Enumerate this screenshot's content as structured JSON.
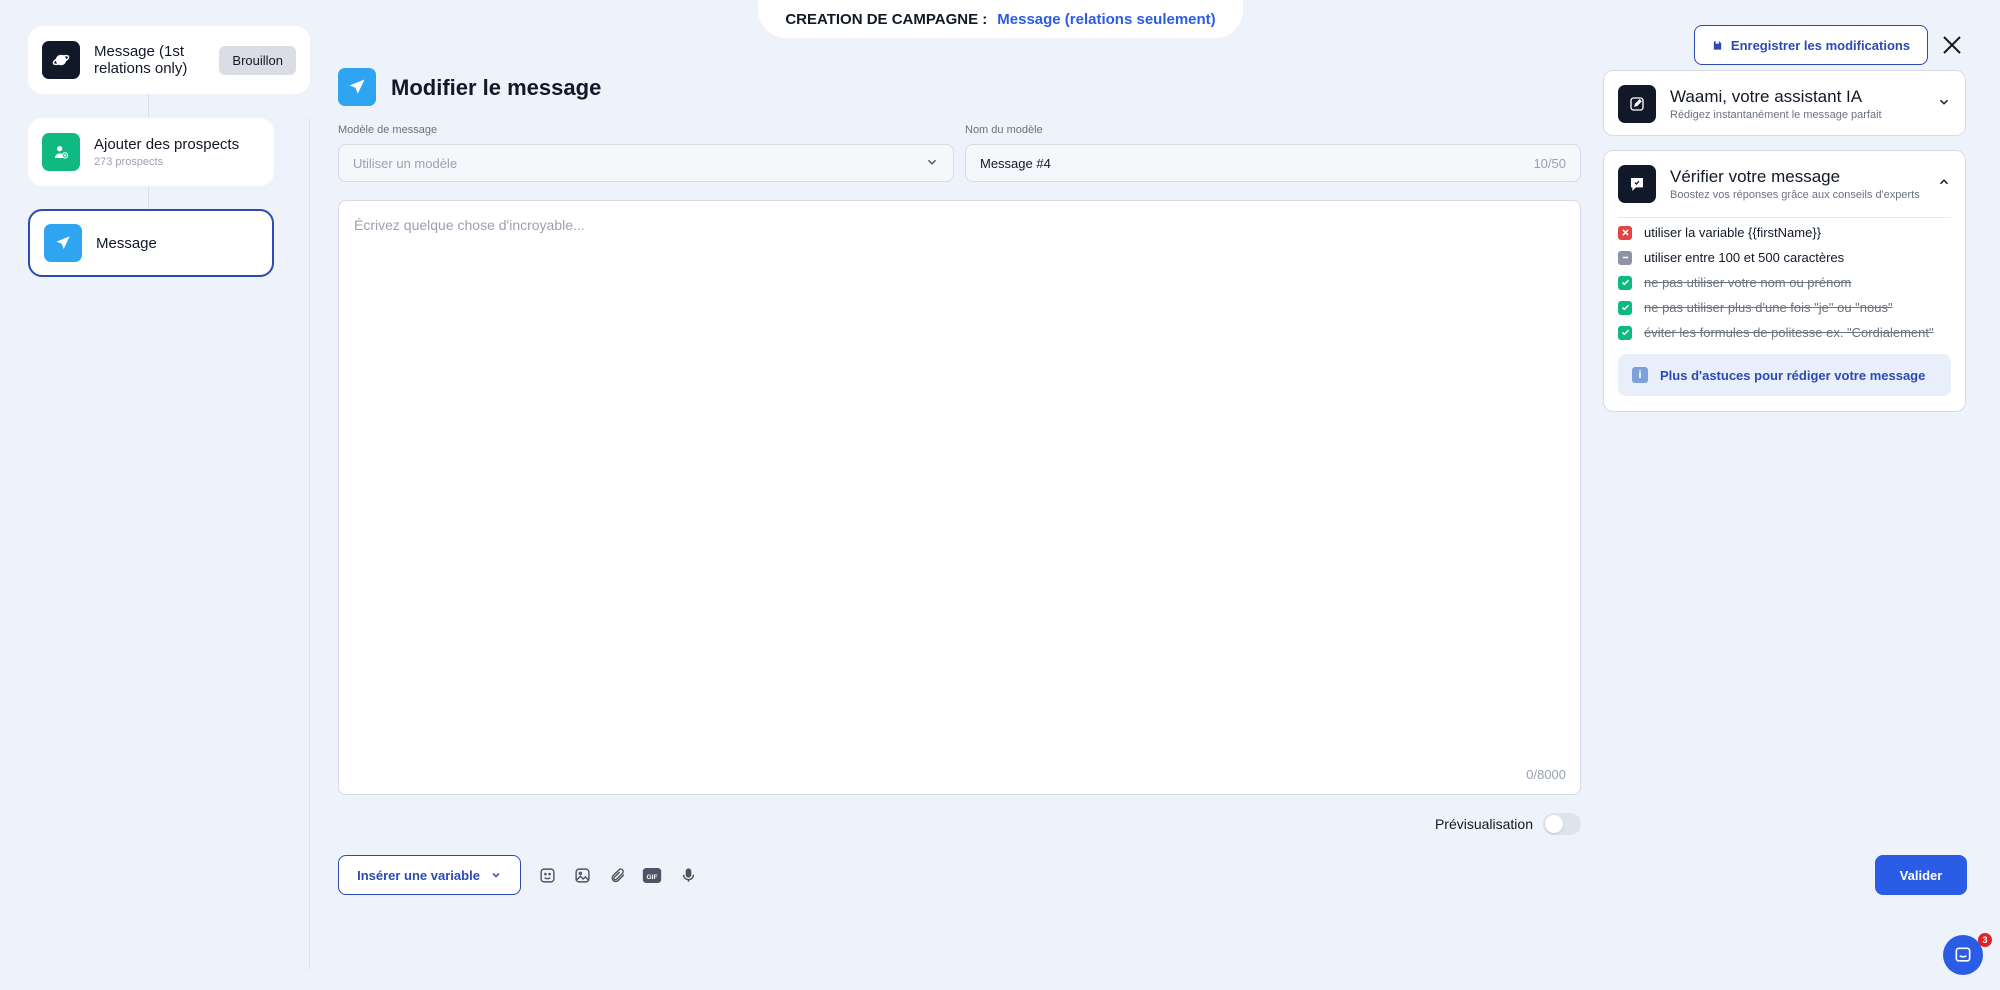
{
  "top_tab": {
    "label": "CREATION DE CAMPAGNE :",
    "value": "Message (relations seulement)"
  },
  "steps": [
    {
      "title": "Message (1st relations only)",
      "badge": "Brouillon",
      "icon": "planet-icon",
      "color": "#111827"
    },
    {
      "title": "Ajouter des prospects",
      "subtitle": "273 prospects",
      "icon": "add-user-icon",
      "color": "#10b981"
    },
    {
      "title": "Message",
      "icon": "send-icon",
      "color": "#2fa4f0"
    }
  ],
  "header": {
    "title": "Modifier le message"
  },
  "template_field": {
    "label": "Modèle de message",
    "placeholder": "Utiliser un modèle"
  },
  "name_field": {
    "label": "Nom du modèle",
    "value": "Message #4",
    "counter": "10/50"
  },
  "editor": {
    "placeholder": "Écrivez quelque chose d'incroyable...",
    "counter": "0/8000"
  },
  "preview": {
    "label": "Prévisualisation"
  },
  "toolbar": {
    "insert_label": "Insérer une variable",
    "tools": [
      "emoji-icon",
      "image-icon",
      "attachment-icon",
      "gif-icon",
      "microphone-icon"
    ],
    "submit_label": "Valider"
  },
  "right_panel": {
    "save_label": "Enregistrer les modifications",
    "assistant": {
      "title": "Waami, votre assistant IA",
      "subtitle": "Rédigez instantanément le message parfait"
    },
    "verify": {
      "title": "Vérifier votre message",
      "subtitle": "Boostez vos réponses grâce aux conseils d'experts",
      "checks": [
        {
          "text": "utiliser la variable {{firstName}}",
          "status": "error"
        },
        {
          "text": "utiliser entre 100 et 500 caractères",
          "status": "pending"
        },
        {
          "text": "ne pas utiliser votre nom ou prénom",
          "status": "ok"
        },
        {
          "text": "ne pas utiliser plus d'une fois \"je\" ou \"nous\"",
          "status": "ok"
        },
        {
          "text": "éviter les formules de politesse ex. \"Cordialement\"",
          "status": "ok"
        }
      ],
      "tips_label": "Plus d'astuces pour rédiger votre message"
    }
  },
  "chat": {
    "count": "3"
  },
  "colors": {
    "accent": "#2b5ce6",
    "accent_dark": "#2b4bb3",
    "error": "#e04646",
    "pending": "#8d93a6",
    "ok": "#10b981"
  }
}
